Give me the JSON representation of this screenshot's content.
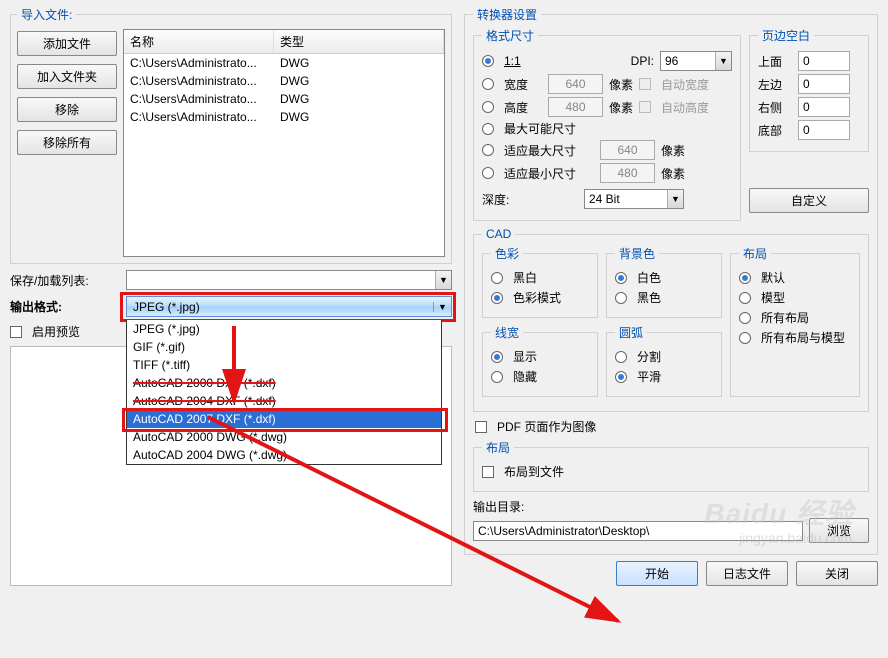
{
  "left": {
    "import_legend": "导入文件:",
    "buttons": {
      "add": "添加文件",
      "add_folder": "加入文件夹",
      "remove": "移除",
      "remove_all": "移除所有"
    },
    "table": {
      "cols": [
        "名称",
        "类型"
      ],
      "rows": [
        {
          "name": "C:\\Users\\Administrato...",
          "type": "DWG"
        },
        {
          "name": "C:\\Users\\Administrato...",
          "type": "DWG"
        },
        {
          "name": "C:\\Users\\Administrato...",
          "type": "DWG"
        },
        {
          "name": "C:\\Users\\Administrato...",
          "type": "DWG"
        }
      ]
    },
    "save_list_label": "保存/加载列表:",
    "output_format_label": "输出格式:",
    "output_format_value": "JPEG (*.jpg)",
    "dropdown": [
      "JPEG (*.jpg)",
      "GIF (*.gif)",
      "TIFF (*.tiff)",
      "AutoCAD 2000 DXF (*.dxf)",
      "AutoCAD 2004 DXF (*.dxf)",
      "AutoCAD 2007 DXF (*.dxf)",
      "AutoCAD 2000 DWG (*.dwg)",
      "AutoCAD 2004 DWG (*.dwg)"
    ],
    "enable_preview": "启用预览"
  },
  "right": {
    "converter_legend": "转换器设置",
    "format_size": {
      "legend": "格式尺寸",
      "one_to_one": "1:1",
      "dpi_label": "DPI:",
      "dpi_value": "96",
      "width_label": "宽度",
      "width_value": "640",
      "px": "像素",
      "auto_width": "自动宽度",
      "height_label": "高度",
      "height_value": "480",
      "auto_height": "自动高度",
      "max_possible": "最大可能尺寸",
      "fit_max": "适应最大尺寸",
      "fit_max_val": "640",
      "fit_min": "适应最小尺寸",
      "fit_min_val": "480",
      "depth_label": "深度:",
      "depth_value": "24 Bit"
    },
    "margins": {
      "legend": "页边空白",
      "top": "上面",
      "left": "左边",
      "right": "右侧",
      "bottom": "底部",
      "val": "0"
    },
    "customize_btn": "自定义",
    "cad": {
      "legend": "CAD",
      "color_legend": "色彩",
      "bw": "黑白",
      "color_mode": "色彩模式",
      "bg_legend": "背景色",
      "white": "白色",
      "black": "黑色",
      "layout_group": "布局",
      "default": "默认",
      "model": "模型",
      "all": "所有布局",
      "all_model": "所有布局与模型",
      "lw_legend": "线宽",
      "show": "显示",
      "hide": "隐藏",
      "arc_legend": "圆弧",
      "split": "分割",
      "smooth": "平滑"
    },
    "pdf_image": "PDF 页面作为图像",
    "layout_legend": "布局",
    "layout_to_file": "布局到文件",
    "output_dir_label": "输出目录:",
    "output_dir_value": "C:\\Users\\Administrator\\Desktop\\",
    "browse": "浏览",
    "start": "开始",
    "log": "日志文件",
    "close": "关闭"
  }
}
